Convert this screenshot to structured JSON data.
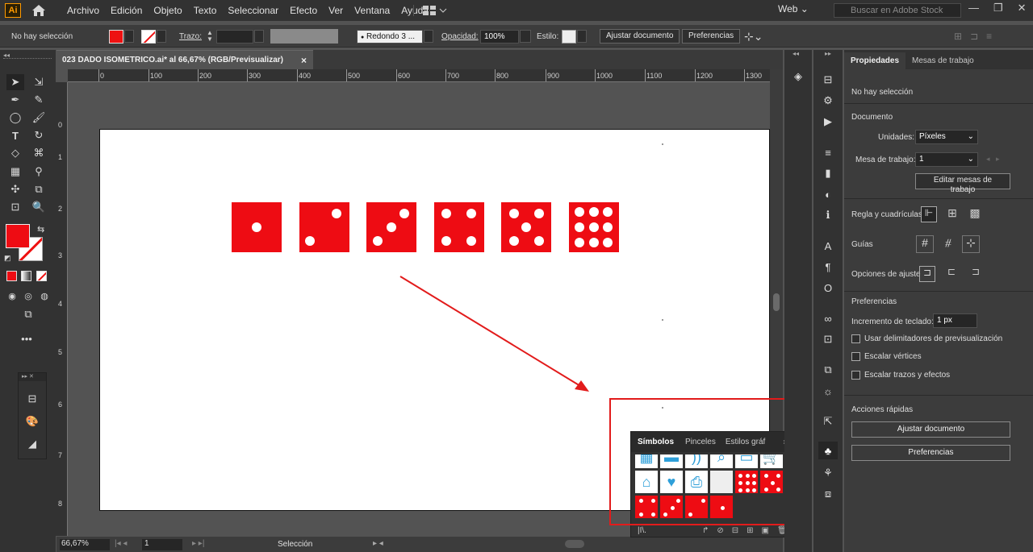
{
  "app": {
    "logo": "Ai",
    "workspace": "Web"
  },
  "menu": [
    "Archivo",
    "Edición",
    "Objeto",
    "Texto",
    "Seleccionar",
    "Efecto",
    "Ver",
    "Ventana",
    "Ayuda"
  ],
  "search": {
    "placeholder": "Buscar en Adobe Stock"
  },
  "control": {
    "selection": "No hay selección",
    "stroke_label": "Trazo:",
    "brush": "Redondo 3 ...",
    "opacity_label": "Opacidad:",
    "opacity": "100%",
    "style_label": "Estilo:",
    "doc_btn": "Ajustar documento",
    "pref_btn": "Preferencias"
  },
  "document": {
    "tab": "023 DADO ISOMETRICO.ai* al 66,67% (RGB/Previsualizar)",
    "close": "×"
  },
  "ruler": {
    "h": [
      "0",
      "100",
      "200",
      "300",
      "400",
      "500",
      "600",
      "700",
      "800",
      "900",
      "1000",
      "1100",
      "1200",
      "1300"
    ],
    "v": [
      "0",
      "1",
      "2",
      "3",
      "4",
      "5",
      "6",
      "7",
      "8"
    ]
  },
  "dice": [
    1,
    2,
    3,
    4,
    5,
    6
  ],
  "status": {
    "zoom": "66,67%",
    "page": "1",
    "tool": "Selección"
  },
  "properties": {
    "tabs": [
      "Propiedades",
      "Mesas de trabajo"
    ],
    "no_selection": "No hay selección",
    "document_title": "Documento",
    "units_label": "Unidades:",
    "units_value": "Píxeles",
    "artboard_label": "Mesa de trabajo:",
    "artboard_value": "1",
    "edit_artboards": "Editar mesas de trabajo",
    "rulers_label": "Regla y cuadrículas",
    "guides_label": "Guías",
    "snap_label": "Opciones de ajuste",
    "prefs_title": "Preferencias",
    "keyboard_label": "Incremento de teclado:",
    "keyboard_value": "1 px",
    "chk1": "Usar delimitadores de previsualización",
    "chk2": "Escalar vértices",
    "chk3": "Escalar trazos y efectos",
    "quick_title": "Acciones rápidas",
    "quick_btn1": "Ajustar documento",
    "quick_btn2": "Preferencias"
  },
  "symbols": {
    "tabs": [
      "Símbolos",
      "Pinceles",
      "Estilos gráf"
    ]
  },
  "colors": {
    "accent_red": "#ee0c13",
    "highlight": "#e21b1b",
    "ui_dark": "#323232"
  }
}
